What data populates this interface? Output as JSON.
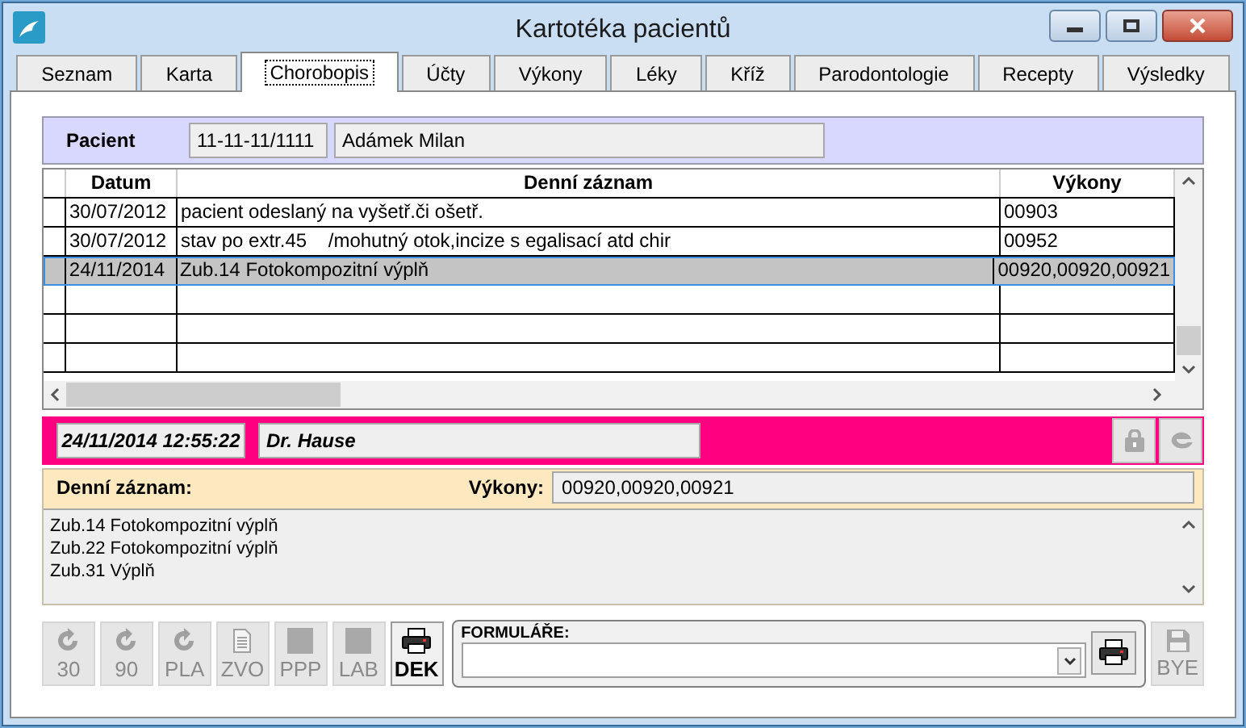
{
  "window": {
    "title": "Kartotéka pacientů"
  },
  "tabs": [
    {
      "label": "Seznam",
      "selected": false
    },
    {
      "label": "Karta",
      "selected": false
    },
    {
      "label": "Chorobopis",
      "selected": true
    },
    {
      "label": "Účty",
      "selected": false
    },
    {
      "label": "Výkony",
      "selected": false
    },
    {
      "label": "Léky",
      "selected": false
    },
    {
      "label": "Kříž",
      "selected": false
    },
    {
      "label": "Parodontologie",
      "selected": false
    },
    {
      "label": "Recepty",
      "selected": false
    },
    {
      "label": "Výsledky",
      "selected": false
    }
  ],
  "patient": {
    "label": "Pacient",
    "id": "11-11-11/1111",
    "name": "Adámek Milan"
  },
  "table": {
    "columns": [
      "Datum",
      "Denní záznam",
      "Výkony"
    ],
    "rows": [
      {
        "cells": [
          "30/07/2012",
          "pacient odeslaný na vyšetř.či ošetř.",
          "00903"
        ],
        "selected": false
      },
      {
        "cells": [
          "30/07/2012",
          "stav po extr.45    /mohutný otok,incize s egalisací atd chir",
          "00952"
        ],
        "selected": false
      },
      {
        "cells": [
          "24/11/2014",
          "Zub.14 Fotokompozitní výplň",
          "00920,00920,00921"
        ],
        "selected": true
      }
    ]
  },
  "record": {
    "timestamp": "24/11/2014 12:55:22",
    "doctor": "Dr. Hause",
    "entry_label": "Denní záznam:",
    "procedures_label": "Výkony:",
    "procedures": "00920,00920,00921",
    "lines": [
      "Zub.14 Fotokompozitní výplň",
      "Zub.22 Fotokompozitní výplň",
      "Zub.31 Výplň"
    ]
  },
  "toolbar": [
    {
      "label": "30",
      "kind": "cycle",
      "disabled": true
    },
    {
      "label": "90",
      "kind": "cycle",
      "disabled": true
    },
    {
      "label": "PLA",
      "kind": "cycle",
      "disabled": true
    },
    {
      "label": "ZVO",
      "kind": "document",
      "disabled": true
    },
    {
      "label": "PPP",
      "kind": "square",
      "disabled": true
    },
    {
      "label": "LAB",
      "kind": "square",
      "disabled": true
    },
    {
      "label": "DEK",
      "kind": "printer",
      "disabled": false
    }
  ],
  "forms": {
    "label": "FORMULÁŘE:"
  },
  "exit": {
    "label": "BYE",
    "disabled": true
  }
}
